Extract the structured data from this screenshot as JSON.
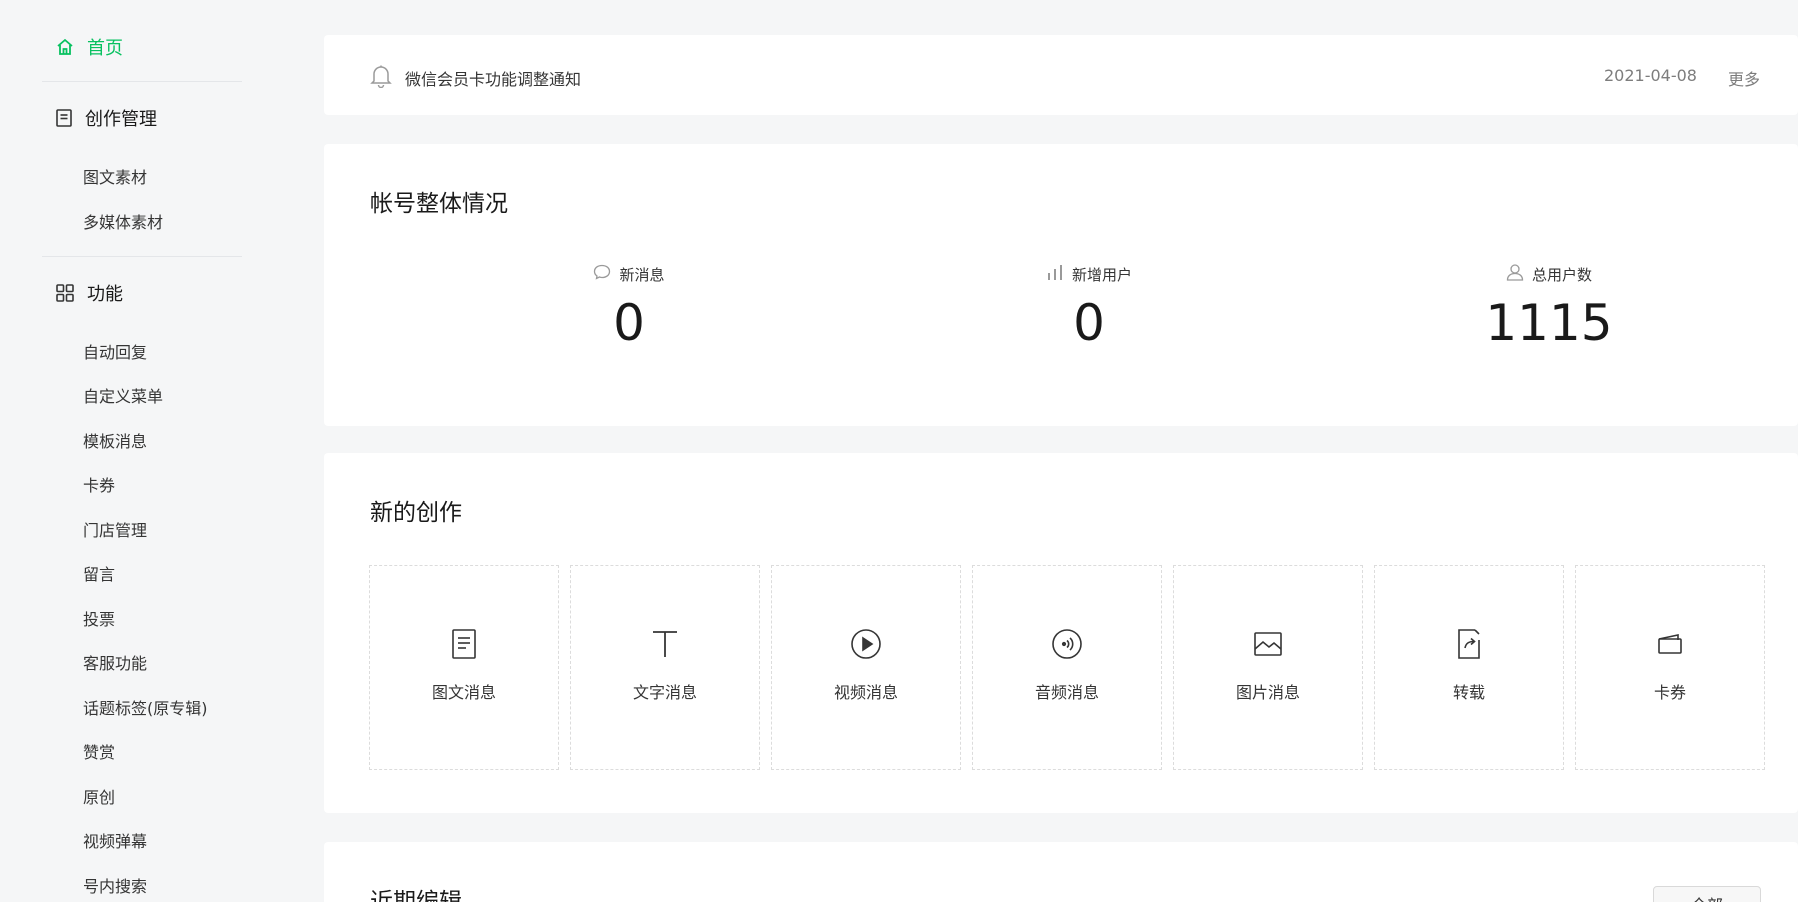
{
  "sidebar": {
    "home": "首页",
    "creation": {
      "label": "创作管理",
      "items": [
        "图文素材",
        "多媒体素材"
      ]
    },
    "functions": {
      "label": "功能",
      "items": [
        "自动回复",
        "自定义菜单",
        "模板消息",
        "卡券",
        "门店管理",
        "留言",
        "投票",
        "客服功能",
        "话题标签(原专辑)",
        "赞赏",
        "原创",
        "视频弹幕",
        "号内搜索"
      ]
    }
  },
  "notice": {
    "text": "微信会员卡功能调整通知",
    "date": "2021-04-08",
    "more": "更多"
  },
  "overview": {
    "title": "帐号整体情况",
    "stats": [
      {
        "label": "新消息",
        "value": "0",
        "icon": "message-icon"
      },
      {
        "label": "新增用户",
        "value": "0",
        "icon": "bar-chart-icon"
      },
      {
        "label": "总用户数",
        "value": "1115",
        "icon": "user-icon"
      }
    ]
  },
  "create": {
    "title": "新的创作",
    "tiles": [
      {
        "label": "图文消息",
        "icon": "article-icon"
      },
      {
        "label": "文字消息",
        "icon": "text-icon"
      },
      {
        "label": "视频消息",
        "icon": "video-icon"
      },
      {
        "label": "音频消息",
        "icon": "audio-icon"
      },
      {
        "label": "图片消息",
        "icon": "image-icon"
      },
      {
        "label": "转载",
        "icon": "repost-icon"
      },
      {
        "label": "卡券",
        "icon": "coupon-icon"
      }
    ]
  },
  "recent": {
    "title": "近期编辑",
    "button": "全部"
  },
  "colors": {
    "accent": "#07c160",
    "background": "#f5f6f7",
    "text": "#1a1a1a",
    "muted": "#7d7d7d"
  }
}
